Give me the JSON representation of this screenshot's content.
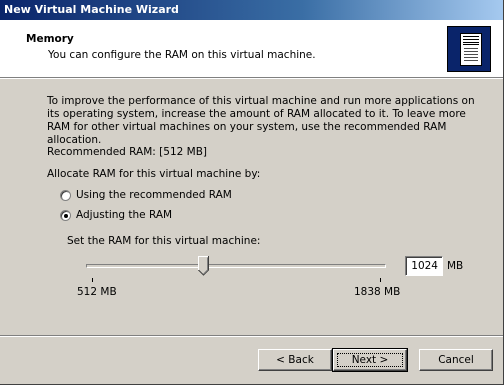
{
  "window": {
    "title": "New Virtual Machine Wizard"
  },
  "header": {
    "title": "Memory",
    "subtitle": "You can configure the RAM on this virtual machine.",
    "icon": "server-tower-icon"
  },
  "body": {
    "description": "To improve the performance of this virtual machine and run more applications on its operating system, increase the amount of RAM allocated to it. To leave more RAM for other virtual machines on your system, use the recommended RAM allocation.",
    "recommended_label": "Recommended RAM: [512 MB]",
    "allocate_label": "Allocate RAM for this virtual machine by:",
    "options": [
      {
        "label": "Using the recommended RAM",
        "checked": false
      },
      {
        "label": "Adjusting the RAM",
        "checked": true
      }
    ],
    "set_label": "Set the RAM for this virtual machine:"
  },
  "slider": {
    "min_label": "512 MB",
    "max_label": "1838 MB",
    "min_value": 512,
    "max_value": 1838,
    "value": 1024
  },
  "ram_input": {
    "value": "1024",
    "unit": "MB"
  },
  "buttons": {
    "back": "< Back",
    "next": "Next >",
    "cancel": "Cancel"
  }
}
